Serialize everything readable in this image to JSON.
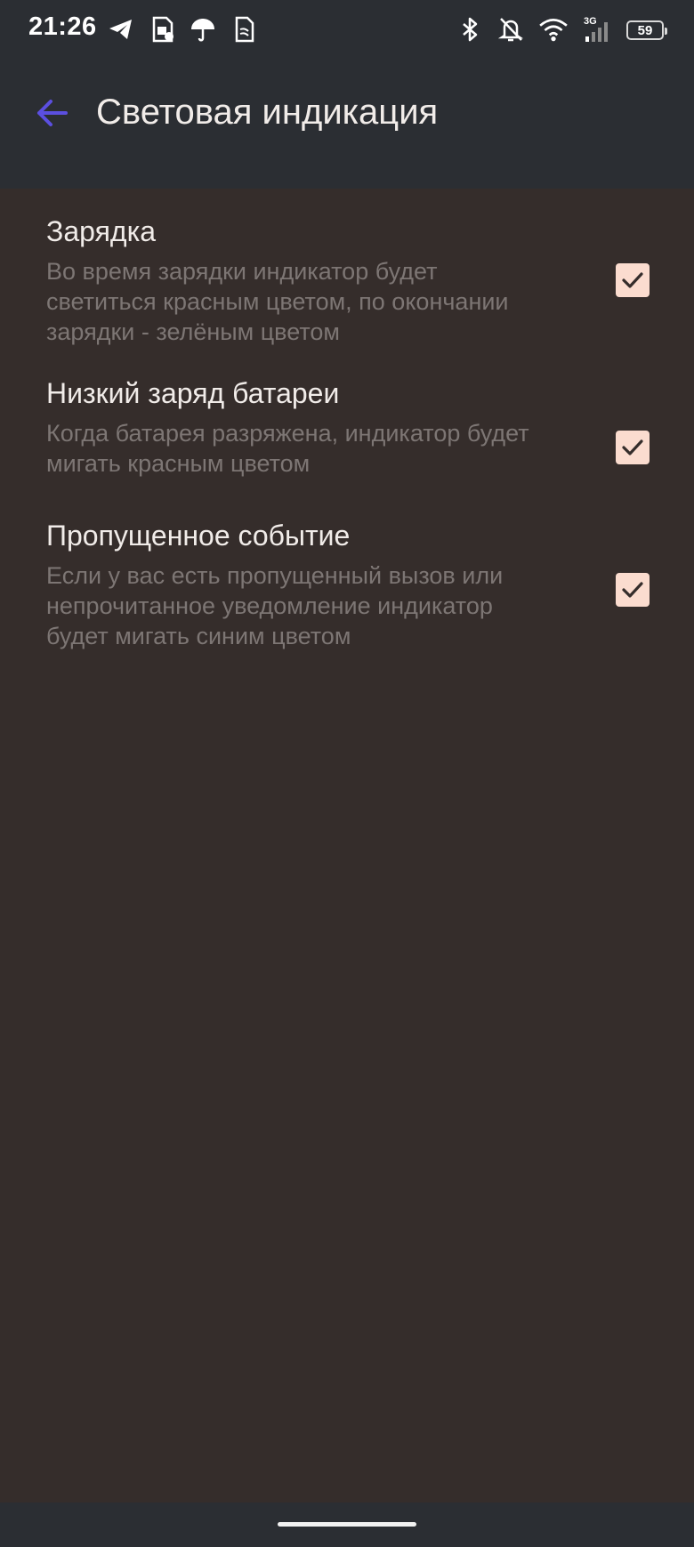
{
  "status_bar": {
    "time": "21:26",
    "battery_level": "59",
    "network_type": "3G",
    "icons": [
      "telegram-icon",
      "sim-settings-icon",
      "umbrella-icon",
      "sim-card-icon",
      "bluetooth-icon",
      "notifications-off-icon",
      "wifi-icon",
      "cellular-signal-icon",
      "battery-icon"
    ]
  },
  "app_bar": {
    "title": "Световая индикация",
    "back_icon": "arrow-left-icon"
  },
  "settings": [
    {
      "title": "Зарядка",
      "desc_lines": [
        "Во время зарядки индикатор будет",
        "светиться красным цветом, по окончании",
        "зарядки - зелёным цветом"
      ],
      "checked": true
    },
    {
      "title": "Низкий заряд батареи",
      "desc_lines": [
        "Когда батарея разряжена, индикатор будет",
        "мигать красным цветом"
      ],
      "checked": true
    },
    {
      "title": "Пропущенное событие",
      "desc_lines": [
        "Если у вас есть пропущенный вызов или",
        "непрочитанное уведомление индикатор",
        "будет мигать синим цветом"
      ],
      "checked": true
    }
  ],
  "colors": {
    "accent": "#5b4fe0",
    "checkbox_fill": "#fbdccf",
    "check_mark": "#352d2b",
    "background": "#352d2b",
    "app_bar": "#2b2e33"
  }
}
